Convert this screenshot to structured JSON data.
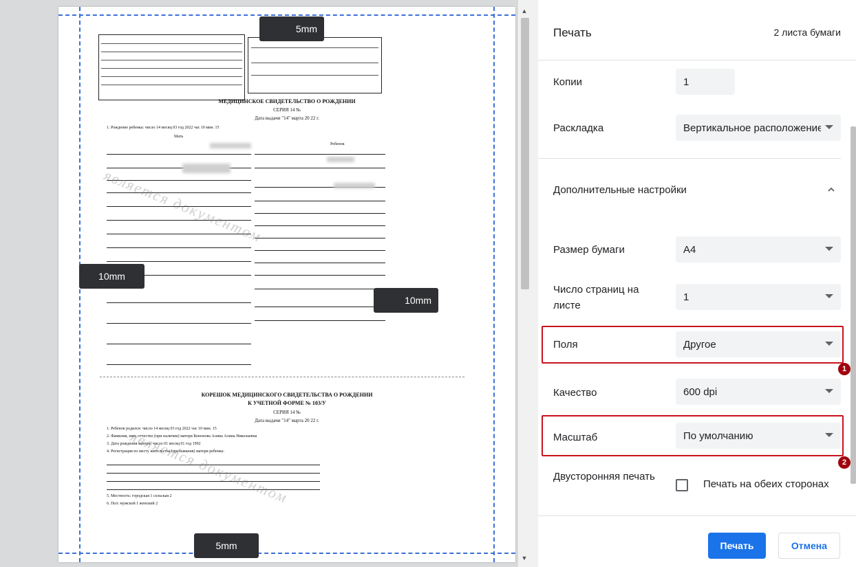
{
  "preview": {
    "margin_badges": {
      "top": "5mm",
      "bottom": "5mm",
      "left": "10mm",
      "right": "10mm"
    },
    "document": {
      "title": "МЕДИЦИНСКОЕ СВИДЕТЕЛЬСТВО О РОЖДЕНИИ",
      "series": "СЕРИЯ 14 №",
      "issue_date": "Дата выдачи \"14\" марта 20 22 г.",
      "row1": "1. Рождение ребенка:   число 14   месяц 03   год 2022   час 10   мин. 15",
      "mother": "Мать",
      "child": "Ребенок",
      "stub_title_1": "КОРЕШОК МЕДИЦИНСКОГО СВИДЕТЕЛЬСТВА О РОЖДЕНИИ",
      "stub_title_2": "К УЧЕТНОЙ ФОРМЕ № 103/У",
      "stub_series": "СЕРИЯ 14 №",
      "stub_date": "Дата выдачи \"14\" марта 20 22 г.",
      "stub_row1": "1. Ребенок родился: число 14   месяц 03   год 2022   час 10   мин. 15",
      "stub_row2": "2. Фамилия, имя, отчество (при наличии) матери   Кононова Алина Алина Николаевна",
      "stub_row3": "3. Дата рождения матери: число 01   месяц 01   год 1992",
      "stub_row4": "4. Регистрация по месту жительства (пребывания) матери ребенка:",
      "stub_row5": "5. Местность: городская 1 сельская 2",
      "stub_row6": "6. Пол: мужской 1 женский 2",
      "watermark_1": "является документом",
      "watermark_2": "является документом"
    }
  },
  "panel": {
    "title": "Печать",
    "sheet_count": "2 листа бумаги",
    "copies": {
      "label": "Копии",
      "value": "1"
    },
    "layout": {
      "label": "Раскладка",
      "value": "Вертикальное расположение"
    },
    "more_settings": {
      "label": "Дополнительные настройки"
    },
    "paper_size": {
      "label": "Размер бумаги",
      "value": "A4"
    },
    "pages_per_sheet": {
      "label": "Число страниц на листе",
      "value": "1"
    },
    "margins": {
      "label": "Поля",
      "value": "Другое",
      "badge": "1"
    },
    "quality": {
      "label": "Качество",
      "value": "600 dpi"
    },
    "scale": {
      "label": "Масштаб",
      "value": "По умолчанию",
      "badge": "2"
    },
    "duplex": {
      "label": "Двусторонняя печать",
      "option": "Печать на обеих сторонах"
    },
    "buttons": {
      "print": "Печать",
      "cancel": "Отмена"
    }
  },
  "colors": {
    "accent": "#1a73e8",
    "highlight": "#c8121b",
    "margin_guides": "#3b6fd6"
  }
}
